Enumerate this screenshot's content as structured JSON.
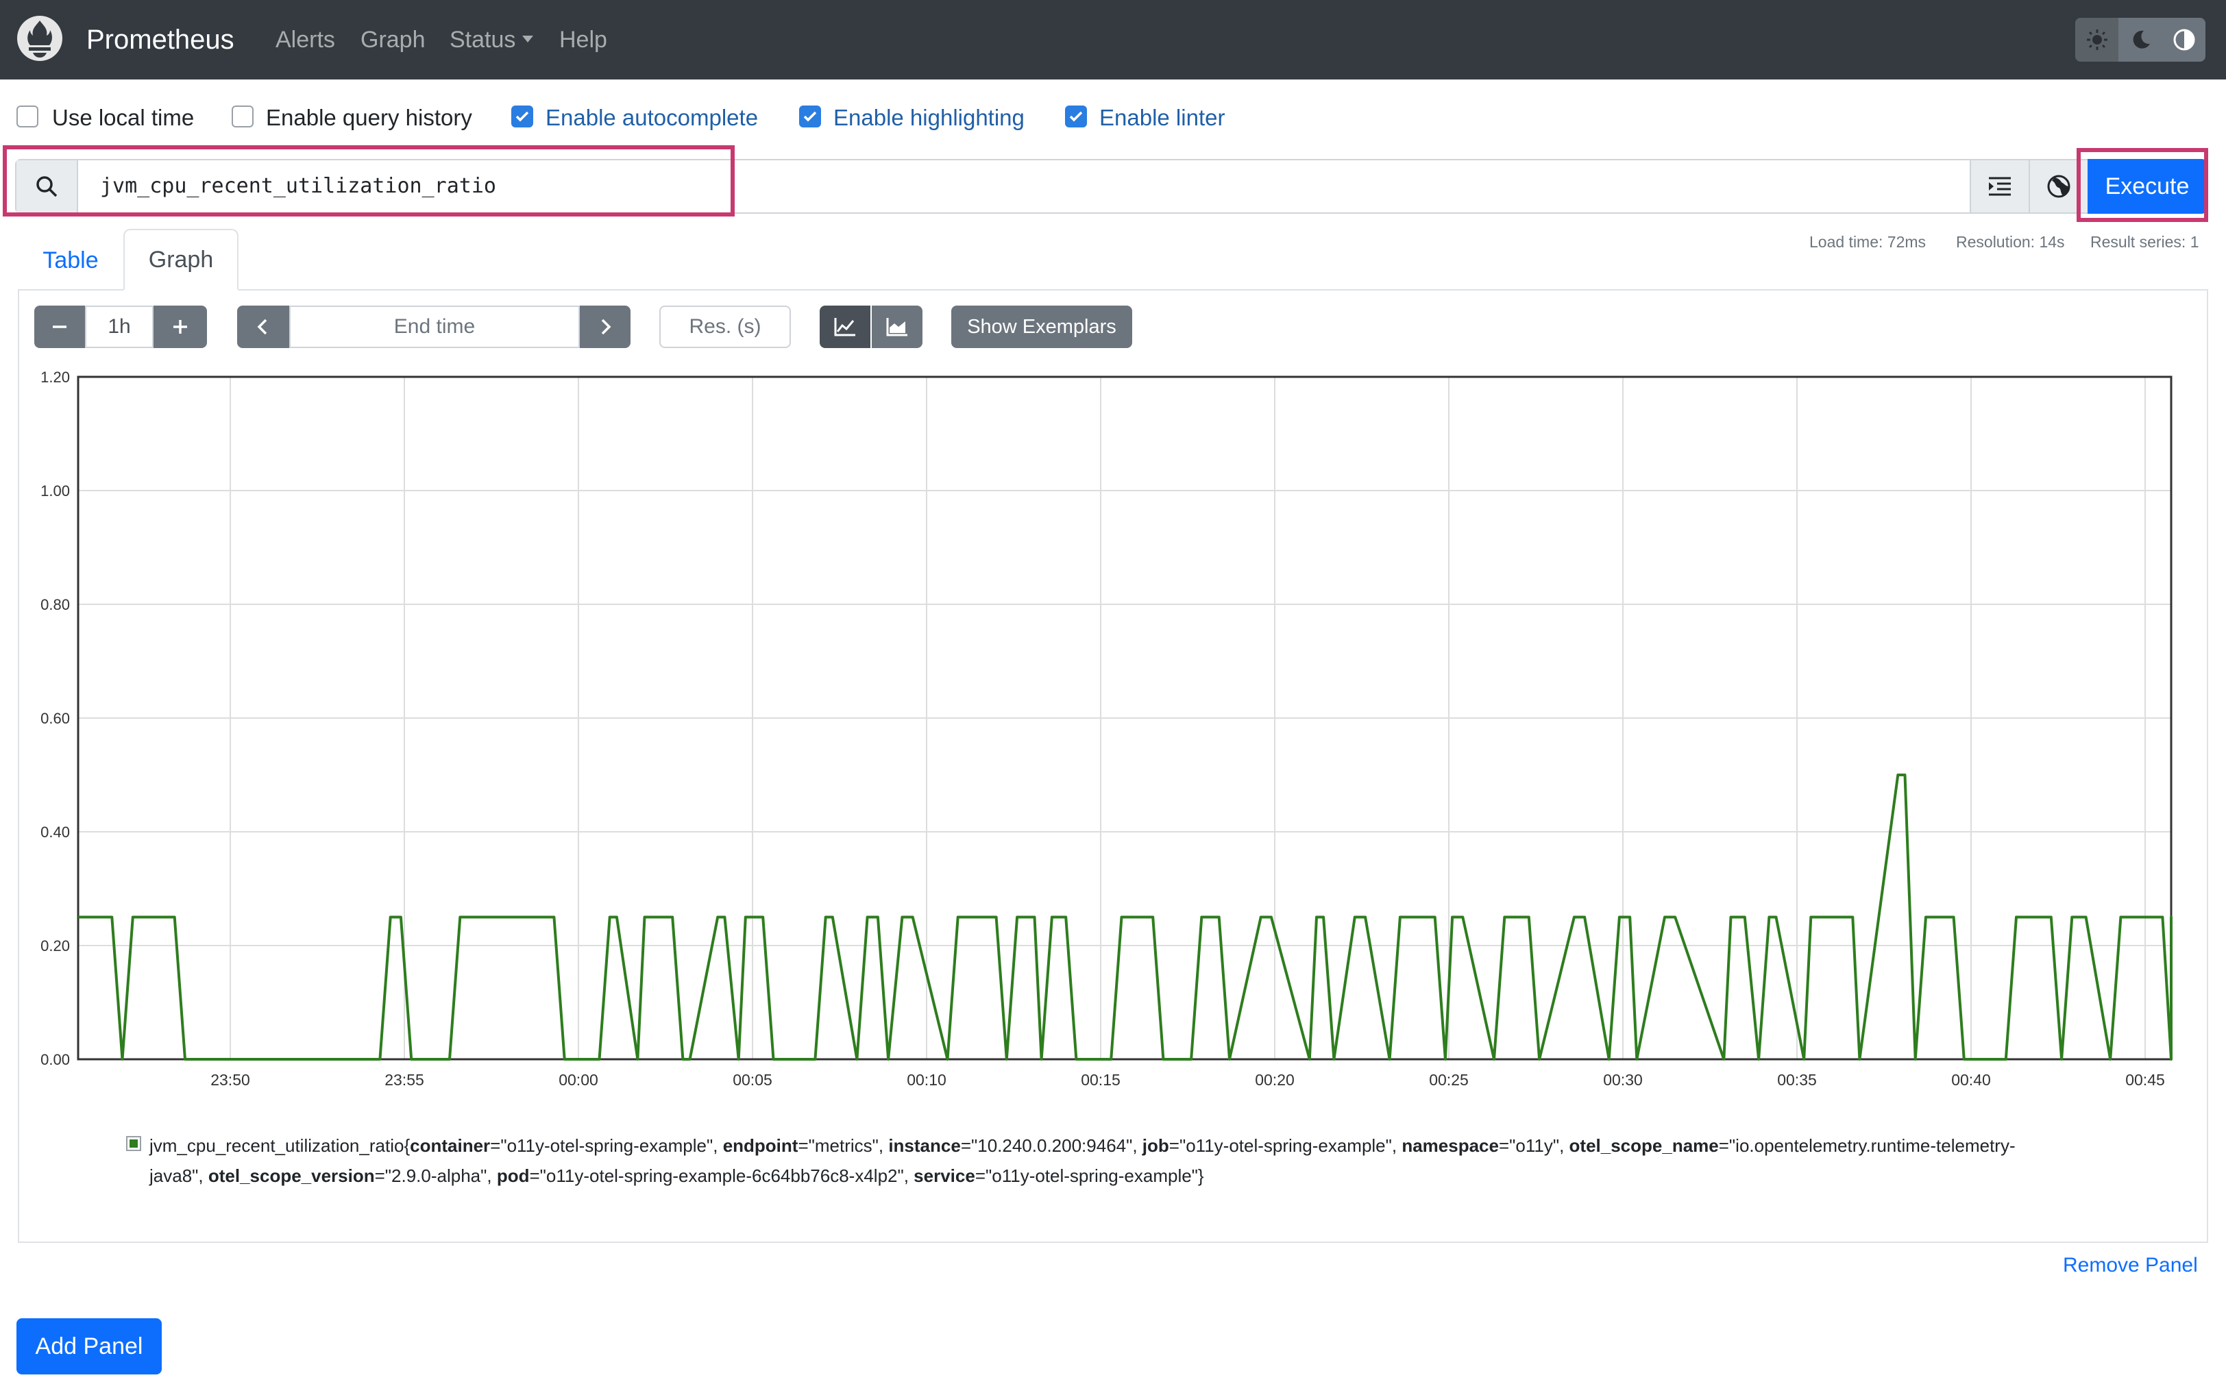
{
  "navbar": {
    "brand": "Prometheus",
    "links": [
      "Alerts",
      "Graph",
      "Status",
      "Help"
    ],
    "theme_icons": [
      "sun-icon",
      "moon-icon",
      "contrast-icon"
    ]
  },
  "options": [
    {
      "label": "Use local time",
      "checked": false
    },
    {
      "label": "Enable query history",
      "checked": false
    },
    {
      "label": "Enable autocomplete",
      "checked": true
    },
    {
      "label": "Enable highlighting",
      "checked": true
    },
    {
      "label": "Enable linter",
      "checked": true
    }
  ],
  "query": {
    "expression": "jvm_cpu_recent_utilization_ratio",
    "execute_label": "Execute"
  },
  "stats": {
    "load_time": "Load time: 72ms",
    "resolution": "Resolution: 14s",
    "result_series": "Result series: 1"
  },
  "tabs": {
    "table": "Table",
    "graph": "Graph",
    "active": "Graph"
  },
  "controls": {
    "range": "1h",
    "end_time_placeholder": "End time",
    "resolution_placeholder": "Res. (s)",
    "show_exemplars": "Show Exemplars"
  },
  "chart_data": {
    "type": "line",
    "yticks": [
      "0.00",
      "0.20",
      "0.40",
      "0.60",
      "0.80",
      "1.00",
      "1.20"
    ],
    "ylim": [
      0,
      1.2
    ],
    "xticks": [
      "23:50",
      "23:55",
      "00:00",
      "00:05",
      "00:10",
      "00:15",
      "00:20",
      "00:25",
      "00:30",
      "00:35",
      "00:40",
      "00:45"
    ],
    "grid": true,
    "color": "#2e7d1e",
    "x_minutes_from_2350": [
      -4.4,
      -3.4,
      -3.1,
      -2.8,
      -1.6,
      -1.3,
      4.3,
      4.6,
      4.9,
      5.2,
      6.3,
      6.6,
      9.3,
      9.6,
      10.6,
      10.9,
      11.1,
      11.7,
      11.9,
      12.7,
      13.0,
      13.2,
      14.0,
      14.2,
      14.6,
      14.8,
      15.3,
      15.6,
      16.8,
      17.1,
      17.3,
      18.0,
      18.3,
      18.6,
      18.9,
      19.3,
      19.6,
      20.6,
      20.9,
      22.0,
      22.3,
      22.6,
      23.1,
      23.3,
      23.6,
      24.0,
      24.3,
      25.3,
      25.6,
      26.5,
      26.8,
      27.6,
      27.9,
      28.4,
      28.7,
      29.6,
      29.9,
      31.0,
      31.2,
      31.4,
      31.7,
      32.3,
      32.6,
      33.3,
      33.6,
      34.6,
      34.9,
      35.1,
      35.4,
      36.3,
      36.6,
      37.3,
      37.6,
      38.6,
      38.9,
      39.6,
      39.9,
      40.2,
      40.4,
      41.2,
      41.5,
      42.9,
      43.1,
      43.5,
      43.9,
      44.2,
      44.4,
      45.2,
      45.4,
      46.6,
      46.8,
      47.9,
      48.1,
      48.4,
      48.7,
      49.5,
      49.8,
      51.0,
      51.3,
      52.3,
      52.6,
      52.9,
      53.3,
      54.0,
      54.3,
      55.5,
      55.8,
      56.8,
      57.0,
      57.6,
      57.9,
      59.0,
      59.2,
      59.6,
      60.2,
      60.4,
      60.8,
      61.2,
      61.4,
      61.8,
      62.3,
      62.6,
      63.7,
      63.9,
      64.4,
      64.7,
      65.6
    ],
    "y_values": [
      0.25,
      0.25,
      0,
      0.25,
      0.25,
      0,
      0,
      0.25,
      0.25,
      0,
      0,
      0.25,
      0.25,
      0,
      0,
      0.25,
      0.25,
      0,
      0.25,
      0.25,
      0,
      0,
      0.25,
      0.25,
      0,
      0.25,
      0.25,
      0,
      0,
      0.25,
      0.25,
      0,
      0.25,
      0.25,
      0,
      0.25,
      0.25,
      0,
      0.25,
      0.25,
      0,
      0.25,
      0.25,
      0,
      0.25,
      0.25,
      0,
      0,
      0.25,
      0.25,
      0,
      0,
      0.25,
      0.25,
      0,
      0.25,
      0.25,
      0,
      0.25,
      0.25,
      0,
      0.25,
      0.25,
      0,
      0.25,
      0.25,
      0,
      0.25,
      0.25,
      0,
      0.25,
      0.25,
      0,
      0.25,
      0.25,
      0,
      0.25,
      0.25,
      0,
      0.25,
      0.25,
      0,
      0.25,
      0.25,
      0,
      0.25,
      0.25,
      0,
      0.25,
      0.25,
      0,
      0.5,
      0.5,
      0,
      0.25,
      0.25,
      0,
      0,
      0.25,
      0.25,
      0,
      0.25,
      0.25,
      0,
      0.25,
      0.25,
      0,
      0.25,
      0.25,
      0,
      0.25,
      0.25,
      0,
      0.25,
      0.25,
      0,
      0.25,
      0.25,
      0,
      0.25,
      0.25,
      0,
      0.25,
      0.25,
      0,
      0.25,
      0.25,
      0,
      0
    ]
  },
  "legend": {
    "metric": "jvm_cpu_recent_utilization_ratio",
    "labels": [
      {
        "key": "container",
        "value": "o11y-otel-spring-example"
      },
      {
        "key": "endpoint",
        "value": "metrics"
      },
      {
        "key": "instance",
        "value": "10.240.0.200:9464"
      },
      {
        "key": "job",
        "value": "o11y-otel-spring-example"
      },
      {
        "key": "namespace",
        "value": "o11y"
      },
      {
        "key": "otel_scope_name",
        "value": "io.opentelemetry.runtime-telemetry-java8"
      },
      {
        "key": "otel_scope_version",
        "value": "2.9.0-alpha"
      },
      {
        "key": "pod",
        "value": "o11y-otel-spring-example-6c64bb76c8-x4lp2"
      },
      {
        "key": "service",
        "value": "o11y-otel-spring-example"
      }
    ]
  },
  "footer": {
    "remove_panel": "Remove Panel",
    "add_panel": "Add Panel"
  }
}
